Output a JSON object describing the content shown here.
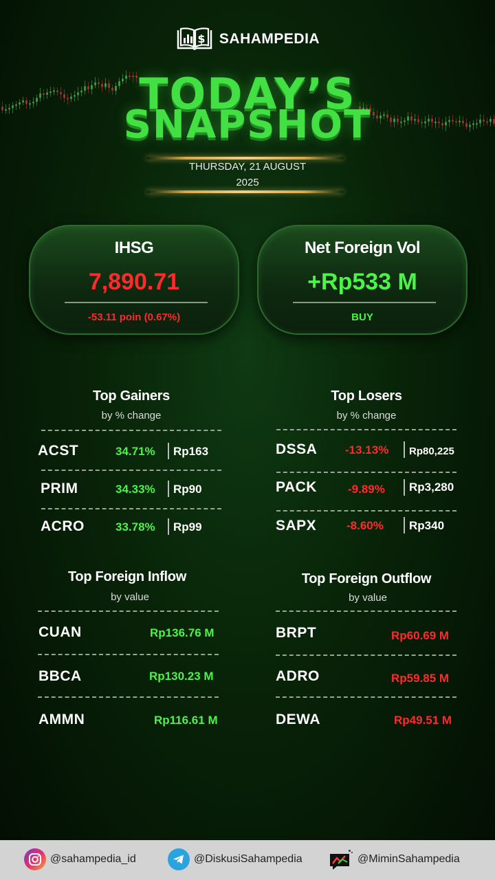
{
  "brand": {
    "name": "SAHAMPEDIA"
  },
  "title": {
    "line1": "TODAY’S",
    "line2": "SNAPSHOT"
  },
  "date": {
    "line1": "THURSDAY, 21 AUGUST",
    "line2": "2025"
  },
  "ihsg": {
    "title": "IHSG",
    "value": "7,890.71",
    "change": "-53.11 poin (0.67%)",
    "color": "#ff2a2a"
  },
  "foreign": {
    "title": "Net Foreign Vol",
    "value": "+Rp533 M",
    "status": "BUY",
    "color": "#4df24a"
  },
  "gainers": {
    "title": "Top Gainers",
    "subtitle": "by % change",
    "rows": [
      {
        "ticker": "ACST",
        "pct": "34.71%",
        "price": "Rp163"
      },
      {
        "ticker": "PRIM",
        "pct": "34.33%",
        "price": "Rp90"
      },
      {
        "ticker": "ACRO",
        "pct": "33.78%",
        "price": "Rp99"
      }
    ]
  },
  "losers": {
    "title": "Top Losers",
    "subtitle": "by % change",
    "rows": [
      {
        "ticker": "DSSA",
        "pct": "-13.13%",
        "price": "Rp80,225"
      },
      {
        "ticker": "PACK",
        "pct": "-9.89%",
        "price": "Rp3,280"
      },
      {
        "ticker": "SAPX",
        "pct": "-8.60%",
        "price": "Rp340"
      }
    ]
  },
  "inflow": {
    "title": "Top Foreign Inflow",
    "subtitle": "by value",
    "rows": [
      {
        "ticker": "CUAN",
        "value": "Rp136.76 M"
      },
      {
        "ticker": "BBCA",
        "value": "Rp130.23 M"
      },
      {
        "ticker": "AMMN",
        "value": "Rp116.61 M"
      }
    ]
  },
  "outflow": {
    "title": "Top Foreign Outflow",
    "subtitle": "by value",
    "rows": [
      {
        "ticker": "BRPT",
        "value": "Rp60.69 M"
      },
      {
        "ticker": "ADRO",
        "value": "Rp59.85 M"
      },
      {
        "ticker": "DEWA",
        "value": "Rp49.51 M"
      }
    ]
  },
  "footer": {
    "instagram": {
      "handle": "@sahampedia_id",
      "icon": "instagram-icon"
    },
    "telegram": {
      "handle": "@DiskusiSahampedia",
      "icon": "telegram-icon"
    },
    "chat": {
      "handle": "@MiminSahampedia",
      "icon": "chat-chart-icon"
    }
  },
  "colors": {
    "up": "#4df24a",
    "down": "#ff2a2a",
    "title_green": "#43e044",
    "gold": "#f3d089"
  }
}
